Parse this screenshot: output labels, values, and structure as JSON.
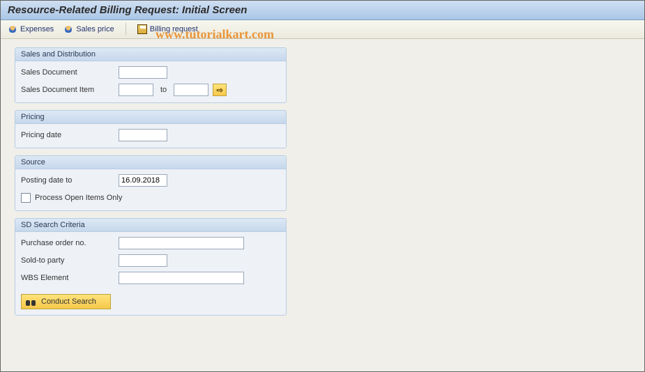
{
  "title": "Resource-Related Billing Request: Initial Screen",
  "watermark": "www.tutorialkart.com",
  "toolbar": {
    "expenses": "Expenses",
    "sales_price": "Sales price",
    "billing_request": "Billing request"
  },
  "groups": {
    "sales": {
      "title": "Sales and Distribution",
      "doc_label": "Sales Document",
      "doc_value": "",
      "item_label": "Sales Document Item",
      "item_from": "",
      "to_label": "to",
      "item_to": ""
    },
    "pricing": {
      "title": "Pricing",
      "date_label": "Pricing date",
      "date_value": ""
    },
    "source": {
      "title": "Source",
      "posting_label": "Posting date to",
      "posting_value": "16.09.2018",
      "open_items_label": "Process Open Items Only",
      "open_items_checked": false
    },
    "search": {
      "title": "SD Search Criteria",
      "po_label": "Purchase order no.",
      "po_value": "",
      "soldto_label": "Sold-to party",
      "soldto_value": "",
      "wbs_label": "WBS Element",
      "wbs_value": "",
      "button_label": "Conduct Search"
    }
  },
  "icons": {
    "multi_selection_glyph": "⇨"
  }
}
